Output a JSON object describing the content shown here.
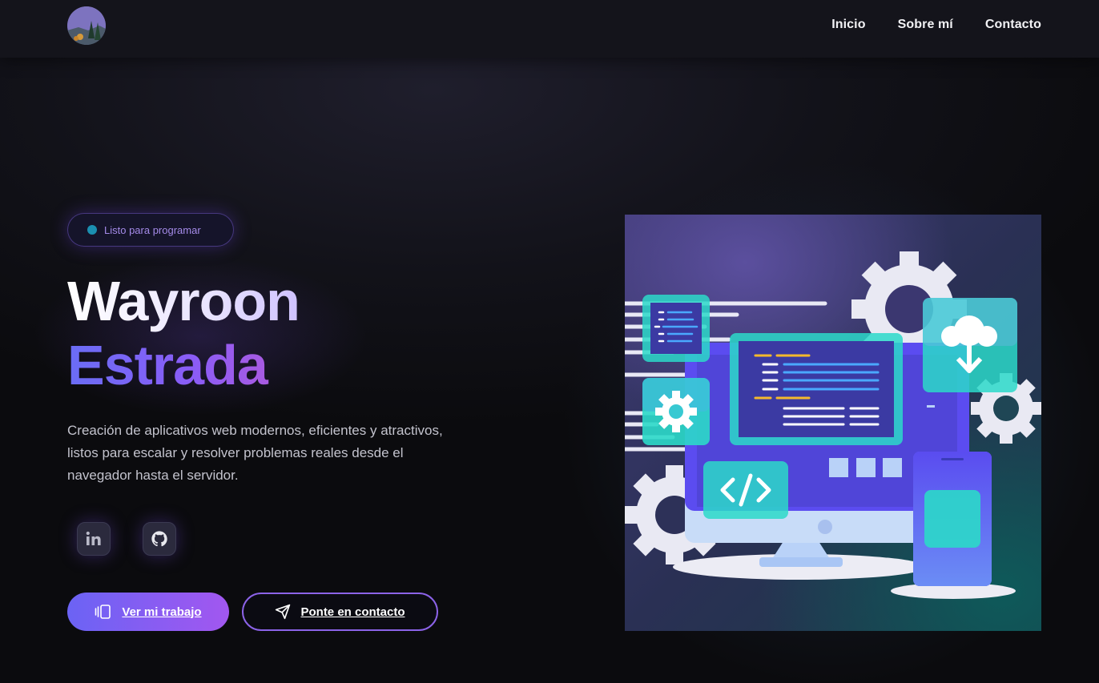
{
  "header": {
    "avatar_alt": "avatar",
    "nav": [
      {
        "label": "Inicio"
      },
      {
        "label": "Sobre mí"
      },
      {
        "label": "Contacto"
      }
    ]
  },
  "hero": {
    "status_badge": "Listo para programar",
    "first_name": "Wayroon",
    "last_name": "Estrada",
    "description": "Creación de aplicativos web modernos, eficientes y atractivos, listos para escalar y resolver problemas reales desde el navegador hasta el servidor.",
    "social": [
      {
        "icon": "linkedin-icon"
      },
      {
        "icon": "github-icon"
      }
    ],
    "primary_button": "Ver mi trabajo",
    "secondary_button": "Ponte en contacto"
  },
  "colors": {
    "accent": "#8b5cf6",
    "accent_blue": "#6a6df5",
    "badge_dot": "#1b8fb0",
    "background": "#0b0b0e"
  }
}
